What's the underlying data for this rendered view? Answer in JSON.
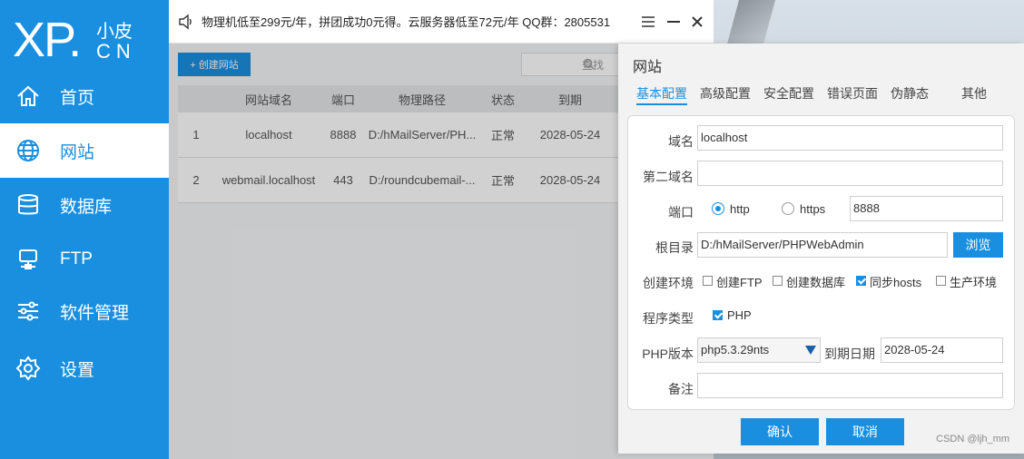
{
  "logo": {
    "main": "XP.",
    "cn_top": "小皮",
    "cn_bottom": "CN"
  },
  "sidebar": {
    "items": [
      {
        "label": "首页",
        "icon": "home-icon"
      },
      {
        "label": "网站",
        "icon": "globe-icon",
        "active": true
      },
      {
        "label": "数据库",
        "icon": "database-icon"
      },
      {
        "label": "FTP",
        "icon": "server-icon"
      },
      {
        "label": "软件管理",
        "icon": "sliders-icon"
      },
      {
        "label": "设置",
        "icon": "gear-icon"
      }
    ]
  },
  "topbar": {
    "notice": "物理机低至299元/年，拼团成功0元得。云服务器低至72元/年  QQ群：2805531"
  },
  "main": {
    "create_button": "+ 创建网站",
    "search_placeholder": "查找",
    "columns": [
      "",
      "网站域名",
      "端口",
      "物理路径",
      "状态",
      "到期"
    ],
    "rows": [
      {
        "idx": "1",
        "domain": "localhost",
        "port": "8888",
        "path": "D:/hMailServer/PH...",
        "status": "正常",
        "expire": "2028-05-24"
      },
      {
        "idx": "2",
        "domain": "webmail.localhost",
        "port": "443",
        "path": "D:/roundcubemail-...",
        "status": "正常",
        "expire": "2028-05-24"
      }
    ]
  },
  "dialog": {
    "title": "网站",
    "tabs": [
      "基本配置",
      "高级配置",
      "安全配置",
      "错误页面",
      "伪静态",
      "其他"
    ],
    "labels": {
      "domain": "域名",
      "second_domain": "第二域名",
      "port": "端口",
      "root": "根目录",
      "env": "创建环境",
      "program_type": "程序类型",
      "php_version": "PHP版本",
      "expire_date": "到期日期",
      "note": "备注"
    },
    "values": {
      "domain": "localhost",
      "second_domain": "",
      "port": "8888",
      "root": "D:/hMailServer/PHPWebAdmin",
      "php_version": "php5.3.29nts",
      "expire_date": "2028-05-24",
      "note": ""
    },
    "protocols": [
      {
        "label": "http",
        "checked": true
      },
      {
        "label": "https",
        "checked": false
      }
    ],
    "env_options": [
      {
        "label": "创建FTP",
        "checked": false
      },
      {
        "label": "创建数据库",
        "checked": false
      },
      {
        "label": "同步hosts",
        "checked": true
      },
      {
        "label": "生产环境",
        "checked": false
      }
    ],
    "program_options": [
      {
        "label": "PHP",
        "checked": true
      }
    ],
    "browse_button": "浏览",
    "confirm_button": "确认",
    "cancel_button": "取消"
  },
  "watermark": "CSDN @ljh_mm",
  "colors": {
    "accent": "#1a8fe0"
  }
}
